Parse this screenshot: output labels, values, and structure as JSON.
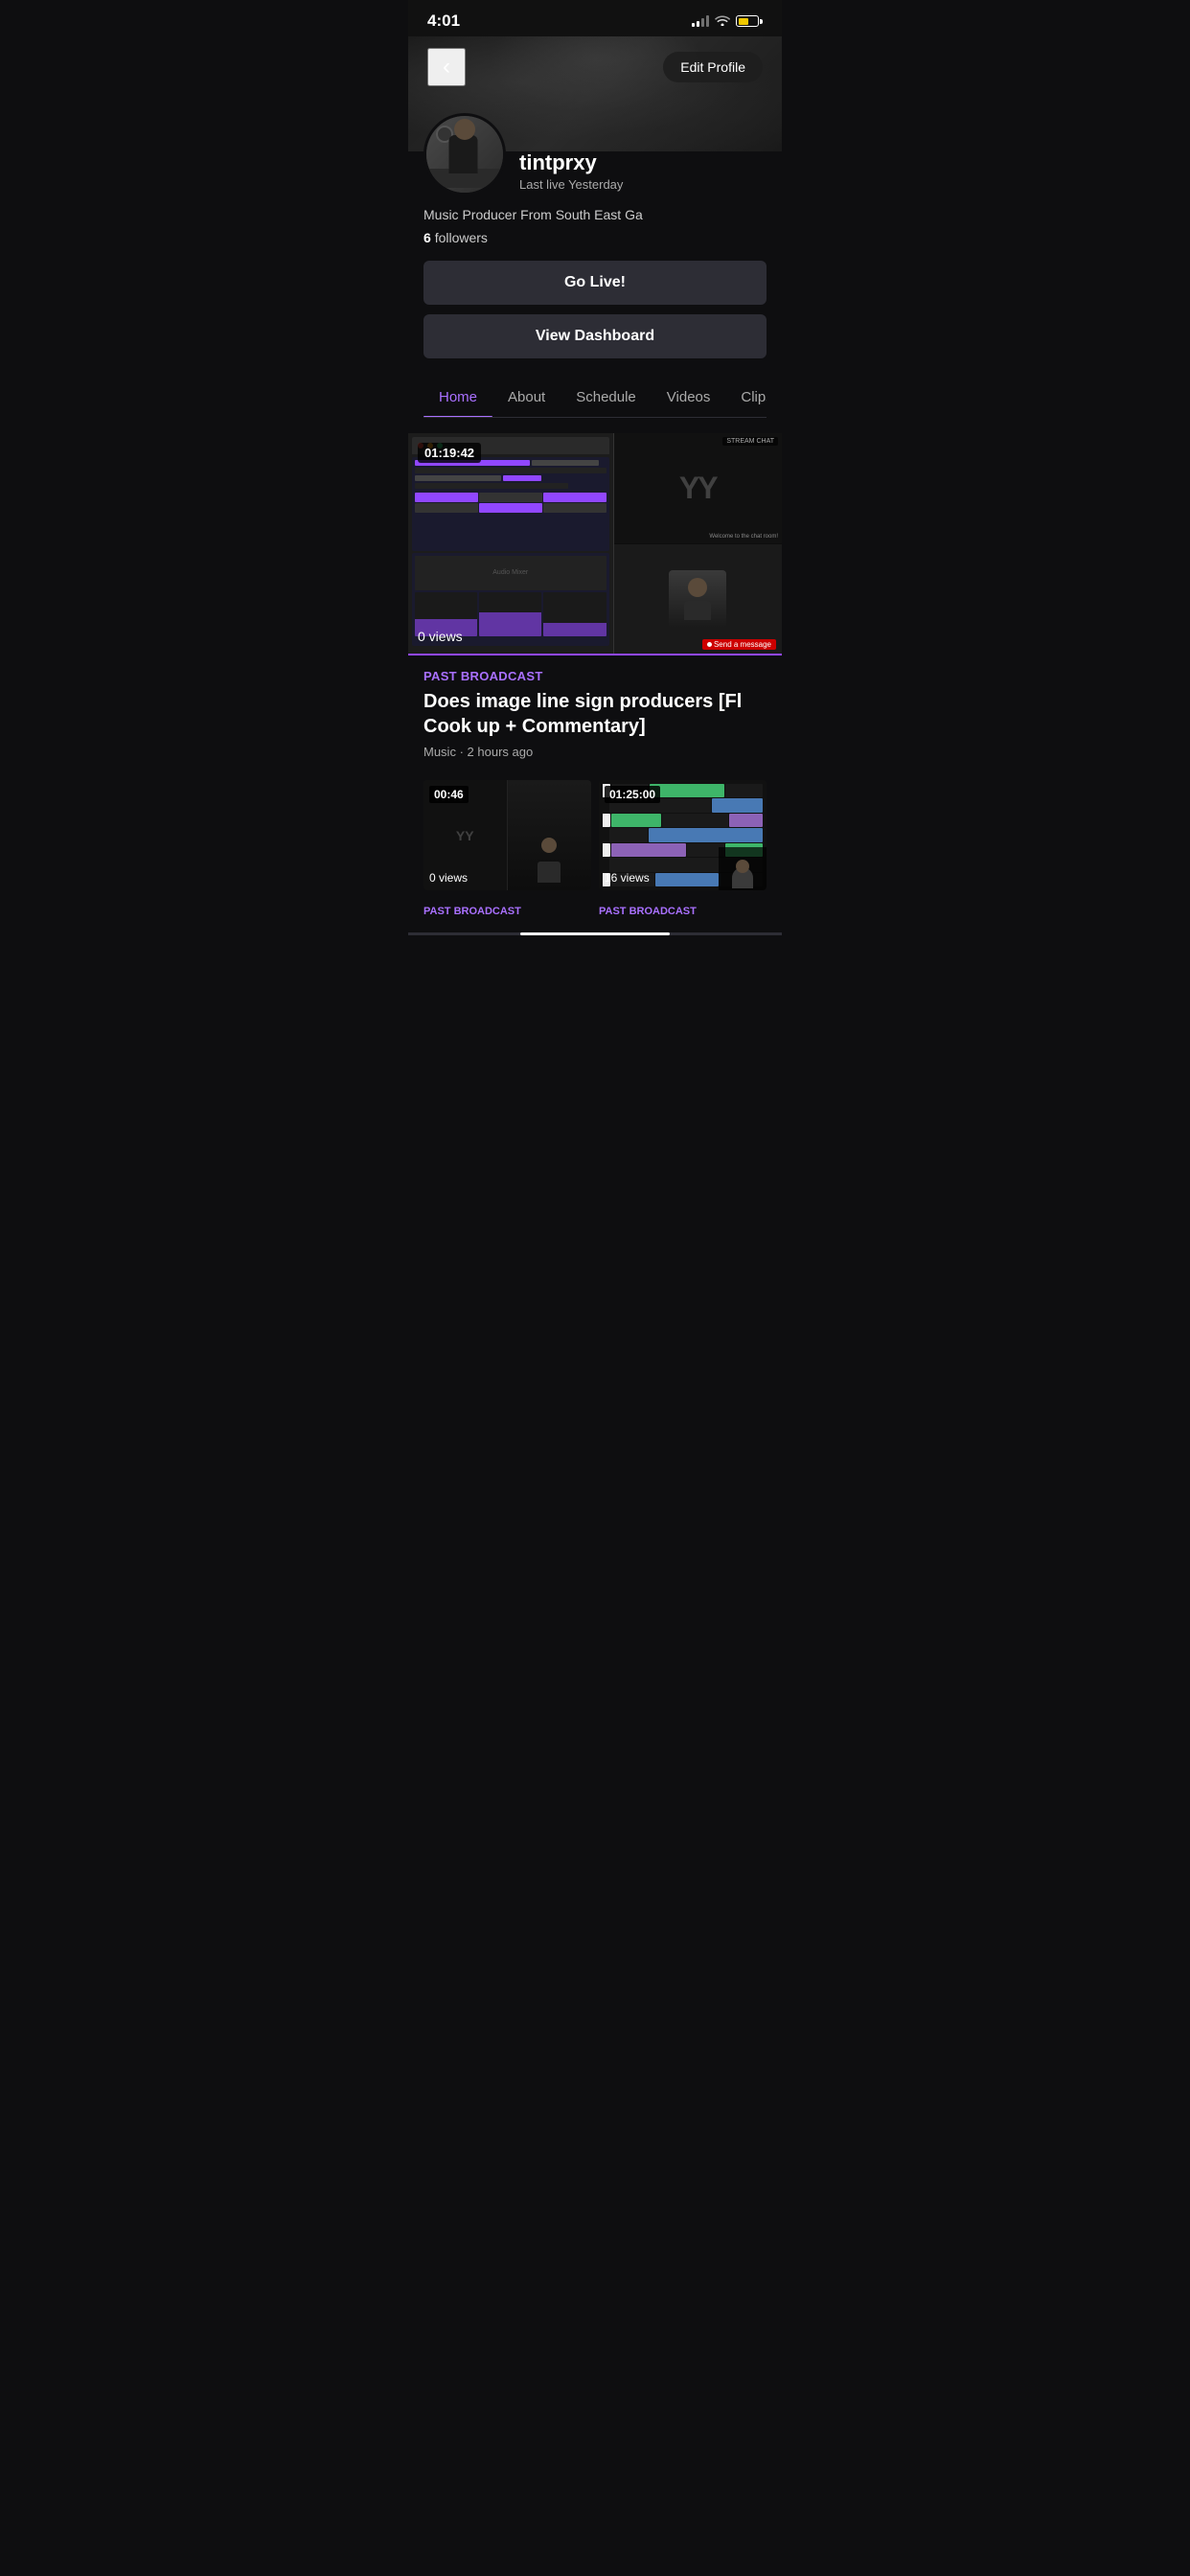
{
  "statusBar": {
    "time": "4:01"
  },
  "header": {
    "backLabel": "<",
    "editProfileLabel": "Edit Profile"
  },
  "profile": {
    "username": "tintprxy",
    "lastLive": "Last live Yesterday",
    "bio": "Music Producer From South East Ga",
    "followers": "6",
    "followersLabel": "followers",
    "goLiveLabel": "Go Live!",
    "viewDashboardLabel": "View Dashboard"
  },
  "tabs": [
    {
      "label": "Home",
      "active": true
    },
    {
      "label": "About",
      "active": false
    },
    {
      "label": "Schedule",
      "active": false
    },
    {
      "label": "Videos",
      "active": false
    },
    {
      "label": "Clips",
      "active": false
    }
  ],
  "featuredStream": {
    "duration": "01:19:42",
    "views": "0 views"
  },
  "pastBroadcast": {
    "sectionLabel": "Past Broadcast",
    "title": "Does image line sign producers [Fl Cook up + Commentary]",
    "category": "Music",
    "timeAgo": "2 hours ago"
  },
  "videoThumbs": [
    {
      "duration": "00:46",
      "views": "0 views"
    },
    {
      "duration": "01:25:00",
      "views": "16 views"
    }
  ],
  "bottomLabels": [
    {
      "label": "Past Broadcast"
    },
    {
      "label": "Past Broadcast"
    }
  ]
}
